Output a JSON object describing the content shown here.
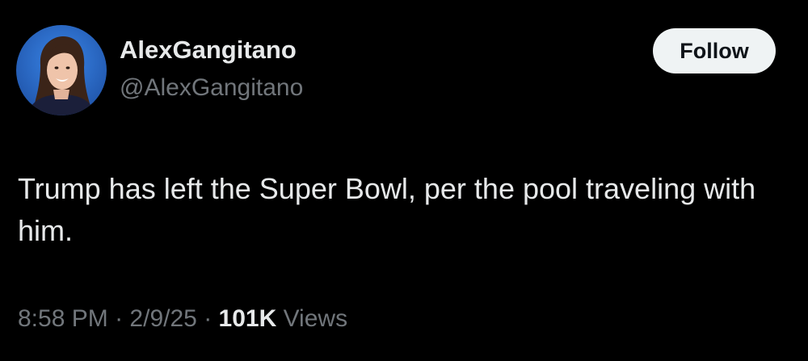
{
  "author": {
    "display_name": "AlexGangitano",
    "handle": "@AlexGangitano",
    "avatar_icon": "profile-photo"
  },
  "follow_button": {
    "label": "Follow"
  },
  "tweet": {
    "text": "Trump has left the Super Bowl, per the pool traveling with him."
  },
  "meta": {
    "time": "8:58 PM",
    "separator": "·",
    "date": "2/9/25",
    "views_count": "101K",
    "views_label": "Views"
  },
  "colors": {
    "background": "#000000",
    "primary_text": "#e7e9ea",
    "secondary_text": "#71767b",
    "button_bg": "#eff3f4",
    "button_text": "#0f1419",
    "avatar_bg": "#2b6fd4"
  }
}
